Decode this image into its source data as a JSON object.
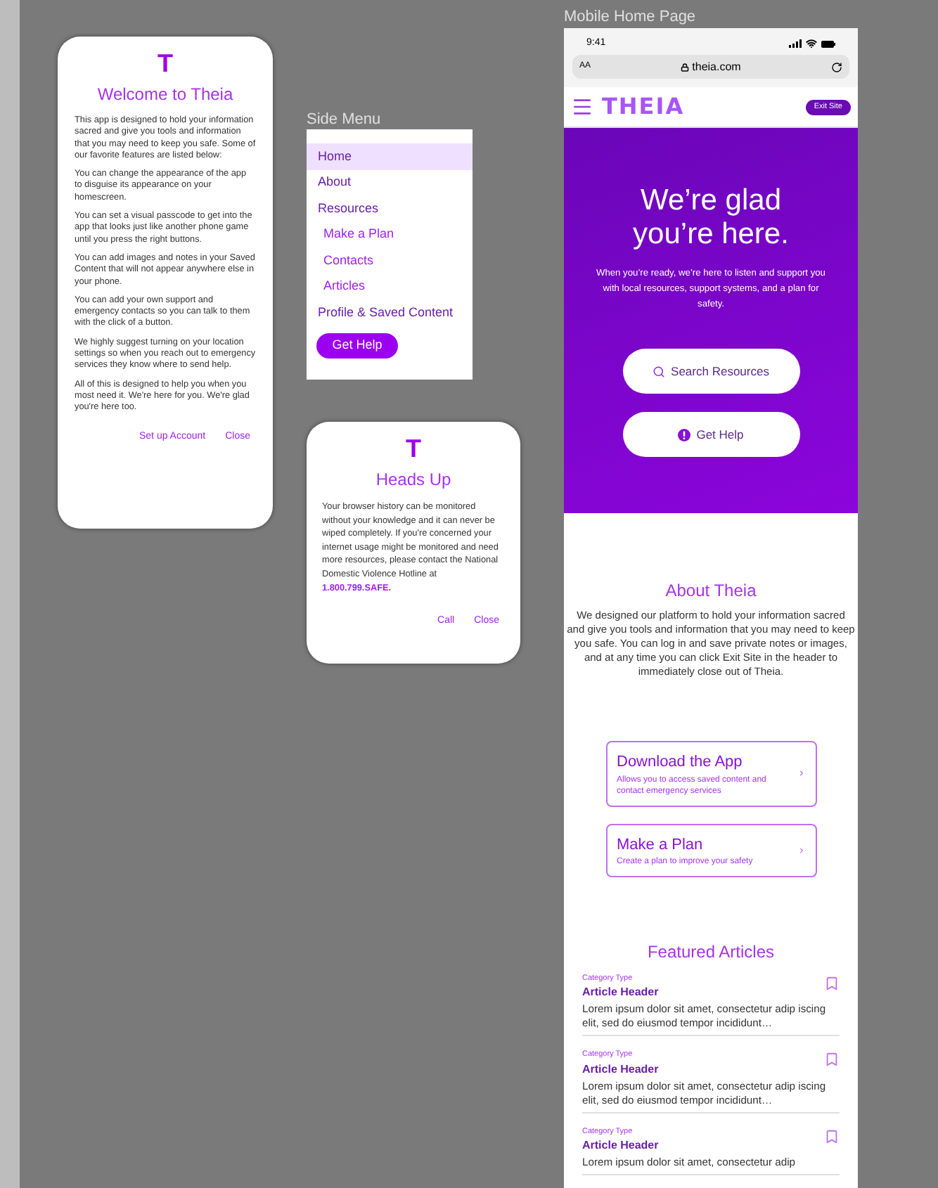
{
  "welcome_card": {
    "logo": "T",
    "title": "Welcome to Theia",
    "paragraphs": [
      "This app is designed to hold your information sacred and give you tools and information that you may need to keep you safe. Some of our favorite features are listed below:",
      "You can change the appearance of the app to disguise its appearance on your homescreen.",
      "You can set a visual passcode to get into the app that looks just like another phone game until you press the right buttons.",
      "You can add images and notes in your Saved Content that will not appear anywhere else in your phone.",
      "You can add your own support and emergency contacts so you can talk to them with the click of a button.",
      "We highly suggest turning on your location settings so when you reach out to emergency services they know where to send help.",
      "All of this is designed to help you when you most need it. We're here for you. We're glad you're here too."
    ],
    "actions": [
      "Set up Account",
      "Close"
    ]
  },
  "side_menu": {
    "label": "Side Menu",
    "items": [
      {
        "label": "Home",
        "selected": true
      },
      {
        "label": "About",
        "selected": false
      },
      {
        "label": "Resources",
        "selected": false,
        "children": [
          {
            "label": "Make a Plan",
            "selected": false
          },
          {
            "label": "Contacts",
            "selected": false
          },
          {
            "label": "Articles",
            "selected": false
          }
        ]
      },
      {
        "label": "Profile & Saved Content",
        "selected": false
      }
    ],
    "button": "Get Help"
  },
  "heads_up_card": {
    "logo": "T",
    "title": "Heads Up",
    "body": "Your browser history can be monitored without your knowledge and it can never be wiped completely. If you're concerned your internet usage might be monitored and need more resources, please contact the National Domestic Violence Hotline at **1.800.799.SAFE.**",
    "actions": [
      "Call",
      "Close"
    ]
  },
  "mobile_home": {
    "label": "Mobile Home Page",
    "status_time": "9:41",
    "text_size": "AA",
    "url": "theia.com",
    "logo": "THEIA",
    "exit_button": "Exit Site",
    "hero": {
      "title": "We’re glad you’re here.",
      "subtitle": "When you’re ready, we’re here to listen and support you with local resources, support systems, and a plan for safety.",
      "buttons": [
        {
          "label": "Search Resources",
          "kind": "search"
        },
        {
          "label": "Get Help",
          "kind": "alert"
        }
      ]
    },
    "about": {
      "title": "About Theia",
      "body": "We designed our platform to hold your information sacred and give you tools and information that you may need to keep you safe. You can log in and save private notes or images, and at any time you can click Exit Site in the header to immediately close out of Theia."
    },
    "cards": [
      {
        "title": "Download the App",
        "description": "Allows you to access saved content and contact emergency services"
      },
      {
        "title": "Make a Plan",
        "description": "Create a plan to improve your safety"
      }
    ],
    "featured_title": "Featured Articles",
    "articles": [
      {
        "category": "Category Type",
        "header": "Article Header",
        "excerpt": "Lorem ipsum dolor sit amet, consectetur adip iscing elit, sed do eiusmod tempor incididunt…"
      },
      {
        "category": "Category Type",
        "header": "Article Header",
        "excerpt": "Lorem ipsum dolor sit amet, consectetur adip iscing elit, sed do eiusmod tempor incididunt…"
      },
      {
        "category": "Category Type",
        "header": "Article Header",
        "excerpt": "Lorem ipsum dolor sit amet, consectetur adip"
      }
    ]
  }
}
